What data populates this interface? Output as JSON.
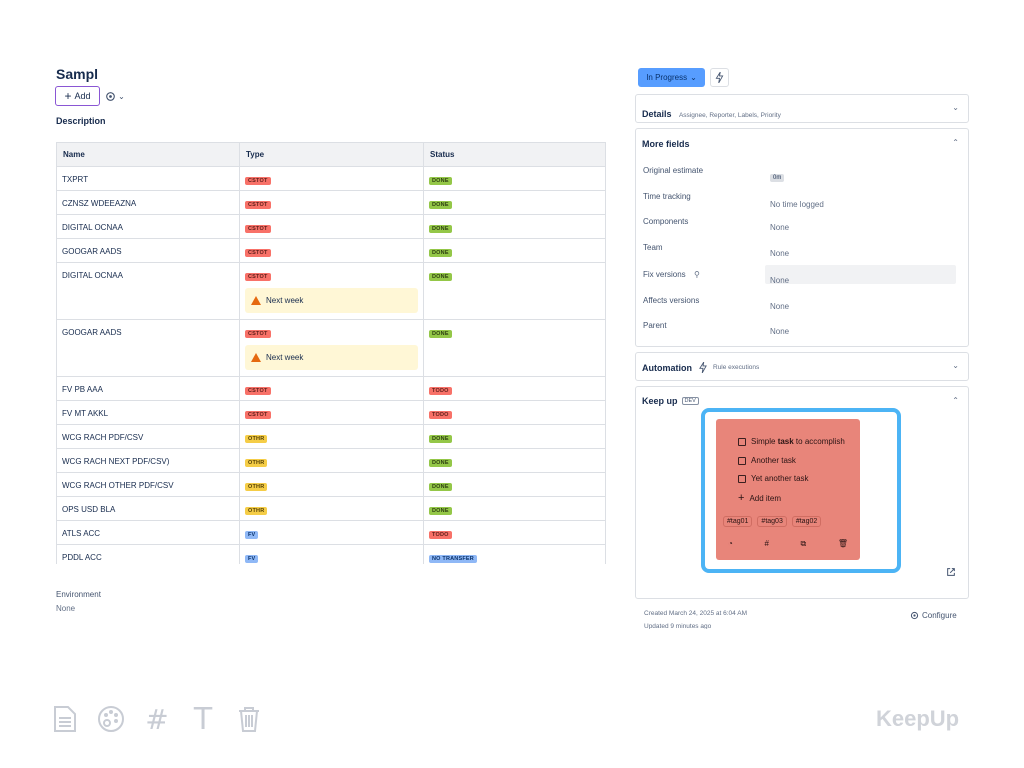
{
  "issue": {
    "title": "Sampl",
    "add_label": "Add",
    "description_label": "Description"
  },
  "table": {
    "headers": [
      "Name",
      "Type",
      "Status"
    ],
    "rows": [
      {
        "name": "TXPRT",
        "type": "CSTOT",
        "status": "DONE"
      },
      {
        "name": "CZNSZ WDEEAZNA",
        "type": "CSTOT",
        "status": "DONE"
      },
      {
        "name": "DIGITAL OCNAA",
        "type": "CSTOT",
        "status": "DONE"
      },
      {
        "name": "GOOGAR AADS",
        "type": "CSTOT",
        "status": "DONE"
      },
      {
        "name": "DIGITAL OCNAA",
        "type": "CSTOT",
        "status": "DONE",
        "warning": "Next week"
      },
      {
        "name": "GOOGAR AADS",
        "type": "CSTOT",
        "status": "DONE",
        "warning": "Next week"
      },
      {
        "name": "FV PB AAA",
        "type": "CSTOT",
        "status": "TODO"
      },
      {
        "name": "FV MT AKKL",
        "type": "CSTOT",
        "status": "TODO"
      },
      {
        "name": "WCG RACH PDF/CSV",
        "type": "OTHR",
        "status": "DONE"
      },
      {
        "name": "WCG RACH NEXT PDF/CSV)",
        "type": "OTHR",
        "status": "DONE"
      },
      {
        "name": "WCG RACH OTHER PDF/CSV",
        "type": "OTHR",
        "status": "DONE"
      },
      {
        "name": "OPS USD BLA",
        "type": "OTHR",
        "status": "DONE"
      },
      {
        "name": "ATLS ACC",
        "type": "FV",
        "status": "TODO"
      },
      {
        "name": "PDDL ACC",
        "type": "FV",
        "status": "NO TRANSFER"
      }
    ]
  },
  "environment": {
    "label": "Environment",
    "value": "None"
  },
  "sidebar": {
    "status_label": "In Progress",
    "details": {
      "title": "Details",
      "subtitle": "Assignee, Reporter, Labels, Priority"
    },
    "more_fields": {
      "title": "More fields",
      "fields": [
        {
          "label": "Original estimate",
          "value": "0m"
        },
        {
          "label": "Time tracking",
          "value": "No time logged"
        },
        {
          "label": "Components",
          "value": "None"
        },
        {
          "label": "Team",
          "value": "None"
        },
        {
          "label": "Fix versions",
          "value": "None"
        },
        {
          "label": "Affects versions",
          "value": "None"
        },
        {
          "label": "Parent",
          "value": "None"
        }
      ]
    },
    "automation": {
      "title": "Automation",
      "subtitle": "Rule executions"
    },
    "keep_up": {
      "title": "Keep up",
      "badge": "DEV",
      "note": {
        "items": [
          {
            "pre": "Simple ",
            "bold": "task",
            "post": " to accomplish"
          },
          {
            "pre": "Another task",
            "bold": "",
            "post": ""
          },
          {
            "pre": "Yet another task",
            "bold": "",
            "post": ""
          }
        ],
        "add_item": "Add item",
        "tags": [
          "#tag01",
          "#tag03",
          "#tag02"
        ]
      }
    },
    "created": "Created March 24, 2025 at 6:04 AM",
    "updated": "Updated 9 minutes ago",
    "configure": "Configure"
  },
  "footer": {
    "brand": "KeepUp",
    "icons": [
      "document-icon",
      "palette-icon",
      "hash-icon",
      "text-icon",
      "trash-icon"
    ]
  },
  "colors": {
    "accent": "#579dff",
    "note": "#e8857a",
    "highlight_border": "#4cb4f5",
    "add_border": "#8a56d4"
  }
}
